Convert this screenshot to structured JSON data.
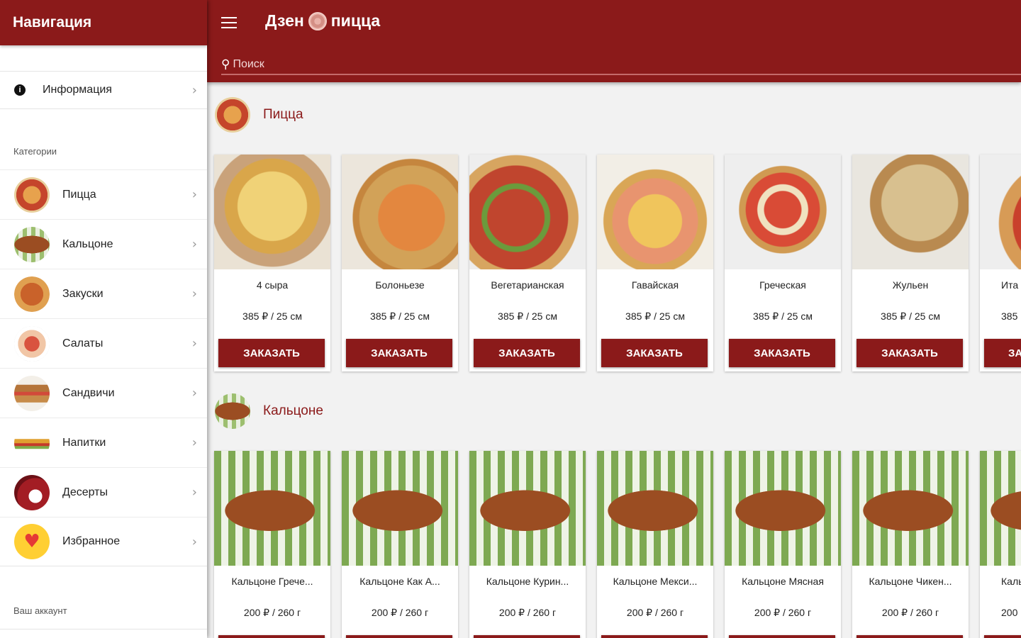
{
  "sidebar": {
    "title": "Навигация",
    "info_label": "Информация",
    "categories_heading": "Категории",
    "account_heading": "Ваш аккаунт",
    "items": [
      {
        "label": "Пицца"
      },
      {
        "label": "Кальцоне"
      },
      {
        "label": "Закуски"
      },
      {
        "label": "Салаты"
      },
      {
        "label": "Сандвичи"
      },
      {
        "label": "Напитки"
      },
      {
        "label": "Десерты"
      },
      {
        "label": "Избранное"
      }
    ]
  },
  "appbar": {
    "brand_left": "Дзен",
    "brand_right": "пицца",
    "search_placeholder": "Поиск"
  },
  "sections": [
    {
      "title": "Пицца",
      "products": [
        {
          "name": "4 сыра",
          "price": "385 ₽ / 25 см",
          "button": "ЗАКАЗАТЬ"
        },
        {
          "name": "Болоньезе",
          "price": "385 ₽ / 25 см",
          "button": "ЗАКАЗАТЬ"
        },
        {
          "name": "Вегетарианская",
          "price": "385 ₽ / 25 см",
          "button": "ЗАКАЗАТЬ"
        },
        {
          "name": "Гавайская",
          "price": "385 ₽ / 25 см",
          "button": "ЗАКАЗАТЬ"
        },
        {
          "name": "Греческая",
          "price": "385 ₽ / 25 см",
          "button": "ЗАКАЗАТЬ"
        },
        {
          "name": "Жульен",
          "price": "385 ₽ / 25 см",
          "button": "ЗАКАЗАТЬ"
        },
        {
          "name": "Ита",
          "price": "385",
          "button": "ЗА"
        }
      ]
    },
    {
      "title": "Кальцоне",
      "products": [
        {
          "name": "Кальцоне Грече...",
          "price": "200 ₽ / 260 г"
        },
        {
          "name": "Кальцоне Как А...",
          "price": "200 ₽ / 260 г"
        },
        {
          "name": "Кальцоне Курин...",
          "price": "200 ₽ / 260 г"
        },
        {
          "name": "Кальцоне Мекси...",
          "price": "200 ₽ / 260 г"
        },
        {
          "name": "Кальцоне Мясная",
          "price": "200 ₽ / 260 г"
        },
        {
          "name": "Кальцоне Чикен...",
          "price": "200 ₽ / 260 г"
        },
        {
          "name": "Кальц",
          "price": "200"
        }
      ]
    }
  ],
  "colors": {
    "primary": "#8b1a1a",
    "background": "#f2f2f2"
  }
}
